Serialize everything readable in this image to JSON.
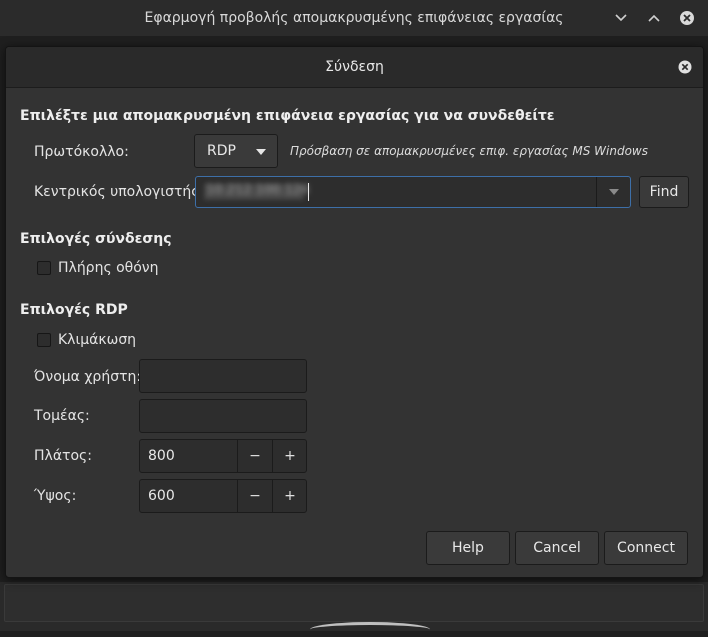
{
  "parent_window": {
    "title": "Εφαρμογή προβολής απομακρυσμένης επιφάνειας εργασίας"
  },
  "dialog": {
    "title": "Σύνδεση",
    "section_connect": "Επιλέξτε μια απομακρυσμένη επιφάνεια εργασίας για να συνδεθείτε",
    "protocol_label": "Πρωτόκολλο:",
    "protocol_value": "RDP",
    "protocol_description": "Πρόσβαση σε απομακρυσμένες επιφ. εργασίας MS Windows",
    "host_label": "Κεντρικός υπολογιστής:",
    "host_value": "10.212.100.124",
    "find_label": "Find",
    "section_connection_options": "Επιλογές σύνδεσης",
    "fullscreen_label": "Πλήρης οθόνη",
    "fullscreen_checked": false,
    "section_rdp_options": "Επιλογές RDP",
    "scaling_label": "Κλιμάκωση",
    "scaling_checked": false,
    "username_label": "Όνομα χρήστη:",
    "username_value": "",
    "domain_label": "Τομέας:",
    "domain_value": "",
    "width_label": "Πλάτος:",
    "width_value": "800",
    "height_label": "Ύψος:",
    "height_value": "600",
    "minus_glyph": "−",
    "plus_glyph": "+",
    "help_label": "Help",
    "cancel_label": "Cancel",
    "connect_label": "Connect"
  },
  "colors": {
    "dialog_bg": "#333333",
    "header_bg": "#2a2a2a",
    "entry_bg": "#2d2d2d",
    "focus_border": "#3d6fa8"
  }
}
